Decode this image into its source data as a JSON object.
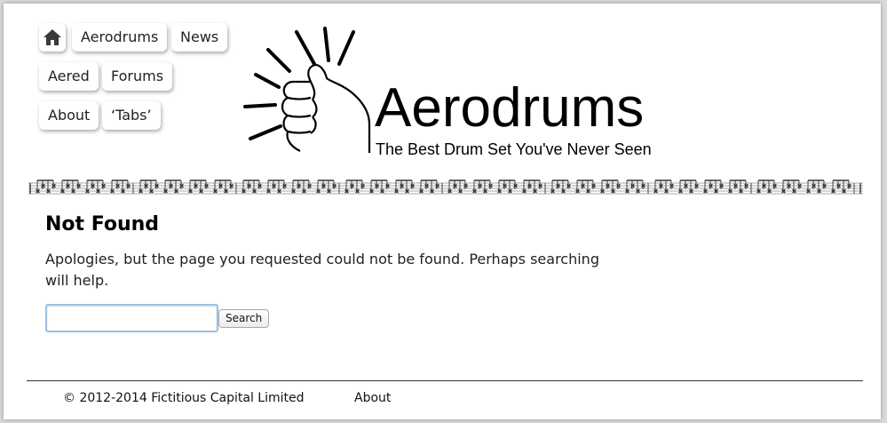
{
  "nav": {
    "home_icon": "home-icon",
    "items": [
      "Aerodrums",
      "News",
      "Aered",
      "Forums",
      "About",
      "‘Tabs’"
    ]
  },
  "logo": {
    "name": "Aerodrums",
    "tagline": "The Best Drum Set You've Never Seen"
  },
  "main": {
    "title": "Not Found",
    "message": "Apologies, but the page you requested could not be found. Perhaps searching will help.",
    "search_value": "",
    "search_button": "Search"
  },
  "footer": {
    "copyright": "© 2012-2014 Fictitious Capital Limited",
    "about": "About"
  },
  "colors": {
    "background": "#ffffff",
    "search_focus": "#9cc1e6",
    "text": "#111111"
  }
}
